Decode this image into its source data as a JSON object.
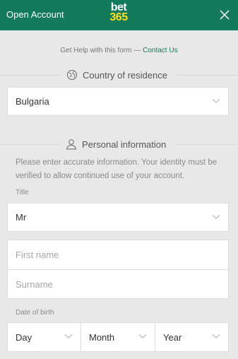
{
  "header": {
    "title": "Open Account",
    "logo_top": "bet",
    "logo_bottom": "365",
    "close_icon": "close-icon"
  },
  "help": {
    "text": "Get Help with this form —",
    "link": "Contact Us"
  },
  "country_section": {
    "heading": "Country of residence",
    "icon": "globe-icon",
    "selected": "Bulgaria"
  },
  "personal_section": {
    "heading": "Personal information",
    "icon": "person-icon",
    "note": "Please enter accurate information. Your identity must be verified to allow continued use of your account.",
    "title_label": "Title",
    "title_value": "Mr",
    "first_name_placeholder": "First name",
    "surname_placeholder": "Surname",
    "dob_label": "Date of birth",
    "dob": {
      "day": "Day",
      "month": "Month",
      "year": "Year"
    }
  },
  "colors": {
    "brand_green": "#137a5a",
    "logo_yellow": "#ffdf1b",
    "background": "#e8e8e8"
  }
}
